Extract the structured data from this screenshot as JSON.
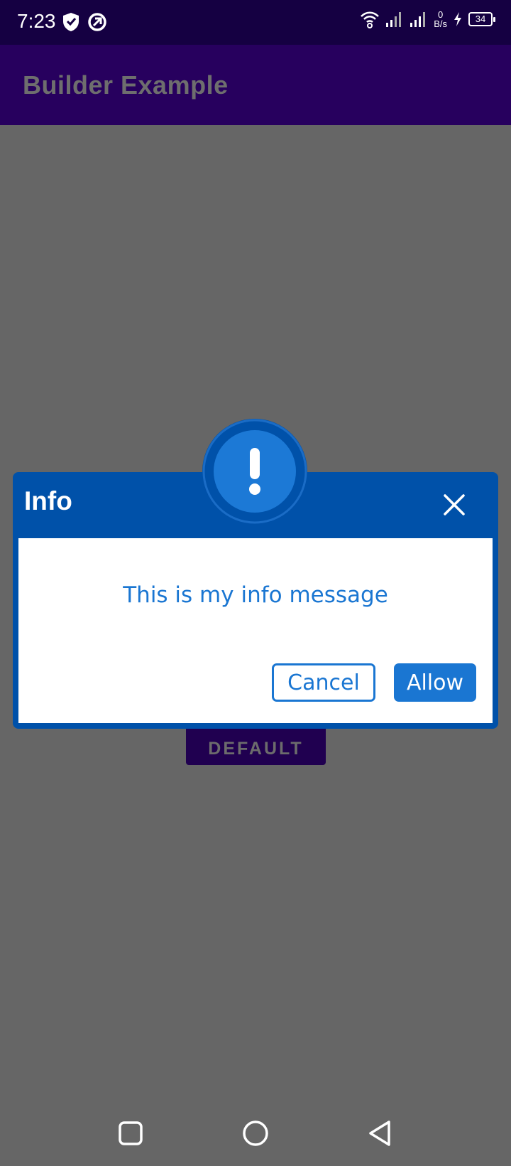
{
  "status_bar": {
    "time": "7:23",
    "net_speed_value": "0",
    "net_speed_unit": "B/s",
    "battery_level": "34"
  },
  "app_bar": {
    "title": "Builder Example"
  },
  "background": {
    "default_button_label": "DEFAULT"
  },
  "dialog": {
    "title": "Info",
    "message": "This is my info message",
    "cancel_label": "Cancel",
    "allow_label": "Allow",
    "icon": "exclamation-icon",
    "close_icon": "close-icon"
  },
  "nav_bar": {
    "icons": [
      "recents-square-icon",
      "home-circle-icon",
      "back-triangle-icon"
    ]
  },
  "colors": {
    "status_bar": "#150042",
    "app_bar": "#27005e",
    "scrim": "#666666",
    "dialog_header": "#0051a9",
    "accent_blue": "#1a76d2"
  }
}
